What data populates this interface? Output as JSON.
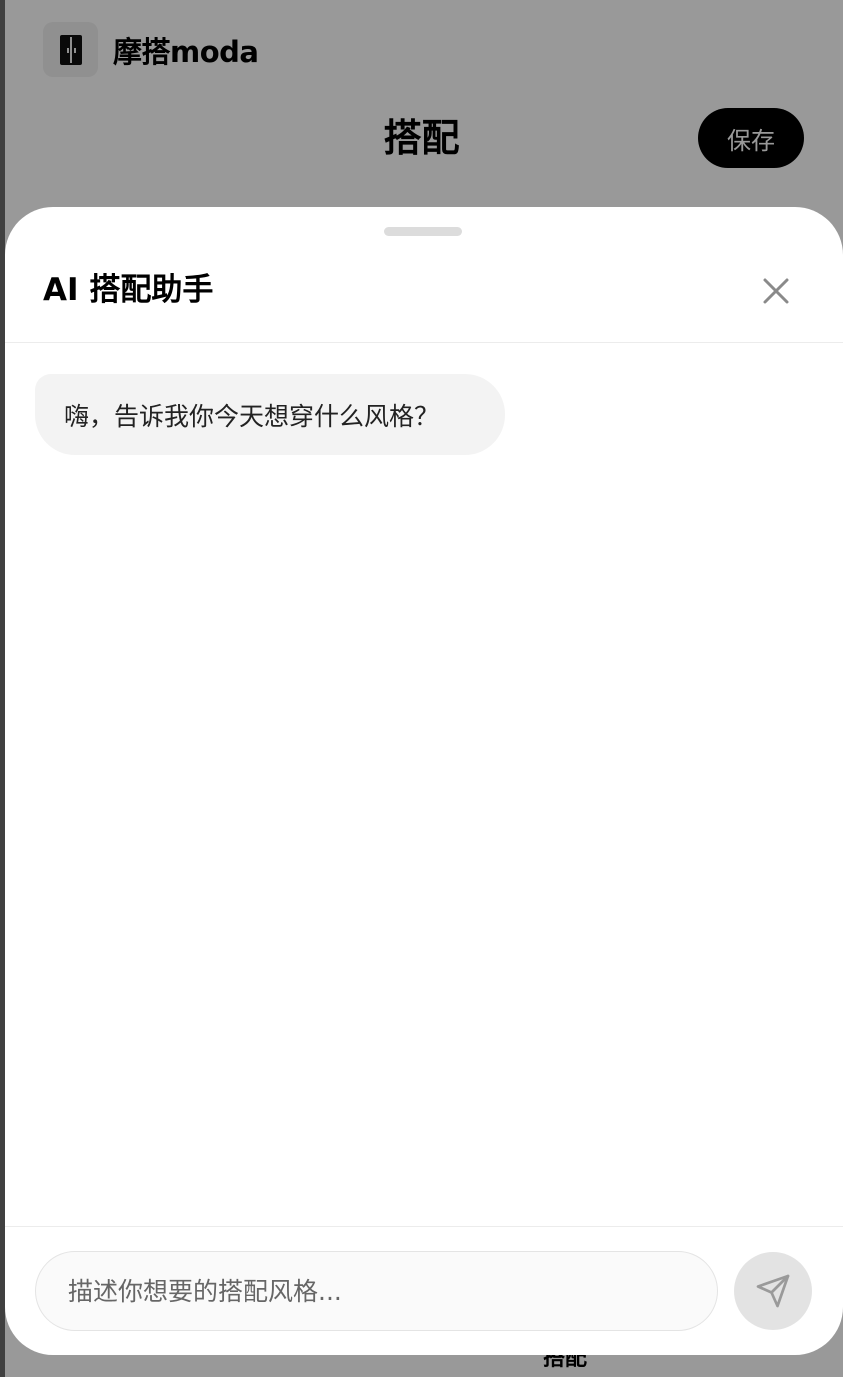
{
  "app": {
    "brand_name": "摩搭moda",
    "page_title": "搭配",
    "save_label": "保存",
    "bottom_tab_label": "搭配"
  },
  "assistant_sheet": {
    "title": "AI 搭配助手",
    "messages": [
      {
        "role": "assistant",
        "text": "嗨，告诉我你今天想穿什么风格？"
      }
    ],
    "input": {
      "value": "",
      "placeholder": "描述你想要的搭配风格..."
    }
  },
  "icons": {
    "logo": "wardrobe-logo-icon",
    "close": "close-icon",
    "send": "send-icon"
  },
  "colors": {
    "primary": "#000000",
    "scrim": "rgba(0,0,0,0.4)",
    "bubble_bg": "#f3f3f3",
    "send_button_disabled": "#e3e3e3"
  }
}
